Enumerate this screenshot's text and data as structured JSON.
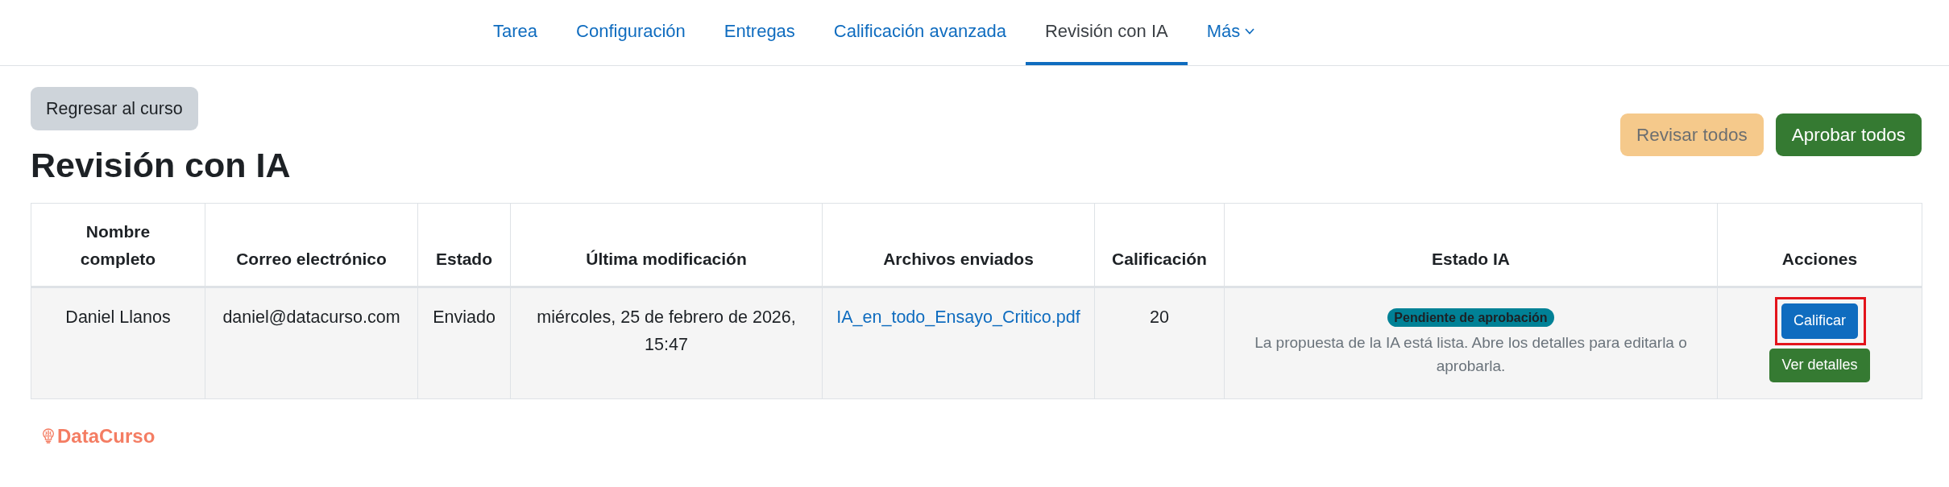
{
  "nav": {
    "tabs": [
      {
        "label": "Tarea",
        "kind": "link",
        "selected": false
      },
      {
        "label": "Configuración",
        "kind": "link",
        "selected": false
      },
      {
        "label": "Entregas",
        "kind": "link",
        "selected": false
      },
      {
        "label": "Calificación avanzada",
        "kind": "link",
        "selected": false
      },
      {
        "label": "Revisión con IA",
        "kind": "link",
        "selected": true
      },
      {
        "label": "Más",
        "kind": "menu",
        "selected": false
      }
    ]
  },
  "back_button": {
    "label": "Regresar al curso"
  },
  "page_title": "Revisión con IA",
  "toolbar": {
    "buttons": [
      {
        "label": "Revisar todos",
        "kind": "warning",
        "disabled": true
      },
      {
        "label": "Aprobar todos",
        "kind": "success",
        "disabled": false
      }
    ]
  },
  "table": {
    "columns": [
      "Nombre completo",
      "Correo electrónico",
      "Estado",
      "Última modificación",
      "Archivos enviados",
      "Calificación",
      "Estado IA",
      "Acciones"
    ],
    "rows": [
      {
        "full_name": "Daniel Llanos",
        "email": "daniel@datacurso.com",
        "status": "Enviado",
        "last_modified": "miércoles, 25 de febrero de 2026, 15:47",
        "files": [
          "IA_en_todo_Ensayo_Critico.pdf"
        ],
        "grade": "20",
        "ai_status": {
          "badge": "Pendiente de aprobación",
          "description": "La propuesta de la IA está lista. Abre los detalles para editarla o aprobarla."
        },
        "actions": [
          {
            "label": "Calificar",
            "kind": "primary",
            "highlighted": true
          },
          {
            "label": "Ver detalles",
            "kind": "success",
            "highlighted": false
          }
        ]
      }
    ]
  },
  "footer": {
    "logo_text": "DataCurso"
  }
}
